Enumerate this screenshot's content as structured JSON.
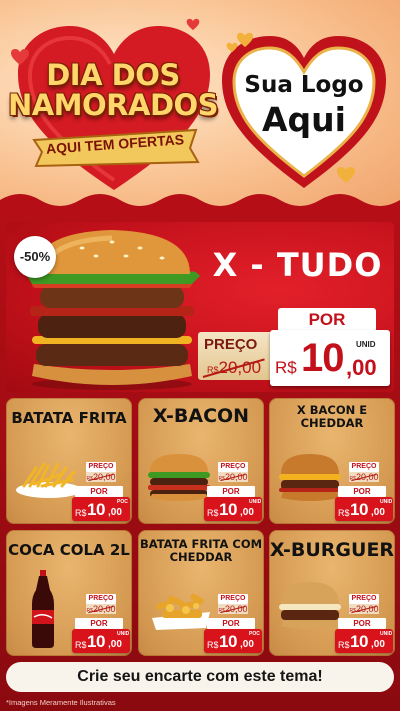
{
  "header": {
    "title_line1": "DIA DOS",
    "title_line2": "NAMORADOS",
    "ribbon": "AQUI TEM OFERTAS",
    "logo_line1": "Sua Logo",
    "logo_line2": "Aqui"
  },
  "hero": {
    "discount": "-50%",
    "name": "X - TUDO",
    "preco_label": "PREÇO",
    "old_currency": "R$",
    "old_price": "20,00",
    "por_label": "POR",
    "currency": "R$",
    "price_int": "10",
    "price_cents": ",00",
    "unit": "UNID"
  },
  "products": [
    {
      "name": "BATATA FRITA",
      "preco_label": "PREÇO",
      "old_currency": "R$",
      "old_price": "20,00",
      "por_label": "POR",
      "currency": "R$",
      "price_int": "10",
      "price_cents": ",00",
      "unit": "POC"
    },
    {
      "name": "X-BACON",
      "preco_label": "PREÇO",
      "old_currency": "R$",
      "old_price": "20,00",
      "por_label": "POR",
      "currency": "R$",
      "price_int": "10",
      "price_cents": ",00",
      "unit": "UNID"
    },
    {
      "name": "X BACON E CHEDDAR",
      "preco_label": "PREÇO",
      "old_currency": "R$",
      "old_price": "20,00",
      "por_label": "POR",
      "currency": "R$",
      "price_int": "10",
      "price_cents": ",00",
      "unit": "UNID"
    },
    {
      "name": "COCA COLA 2L",
      "preco_label": "PREÇO",
      "old_currency": "R$",
      "old_price": "20,00",
      "por_label": "POR",
      "currency": "R$",
      "price_int": "10",
      "price_cents": ",00",
      "unit": "UNID"
    },
    {
      "name": "BATATA FRITA COM CHEDDAR",
      "preco_label": "PREÇO",
      "old_currency": "R$",
      "old_price": "20,00",
      "por_label": "POR",
      "currency": "R$",
      "price_int": "10",
      "price_cents": ",00",
      "unit": "POC"
    },
    {
      "name": "X-BURGUER",
      "preco_label": "PREÇO",
      "old_currency": "R$",
      "old_price": "20,00",
      "por_label": "POR",
      "currency": "R$",
      "price_int": "10",
      "price_cents": ",00",
      "unit": "UNID"
    }
  ],
  "footer": {
    "cta": "Crie seu encarte com este tema!",
    "disclaimer": "*Imagens Meramente Ilustrativas"
  },
  "colors": {
    "brand_red": "#c3111b",
    "gold": "#d59a52",
    "title_yellow": "#ffd66b"
  }
}
